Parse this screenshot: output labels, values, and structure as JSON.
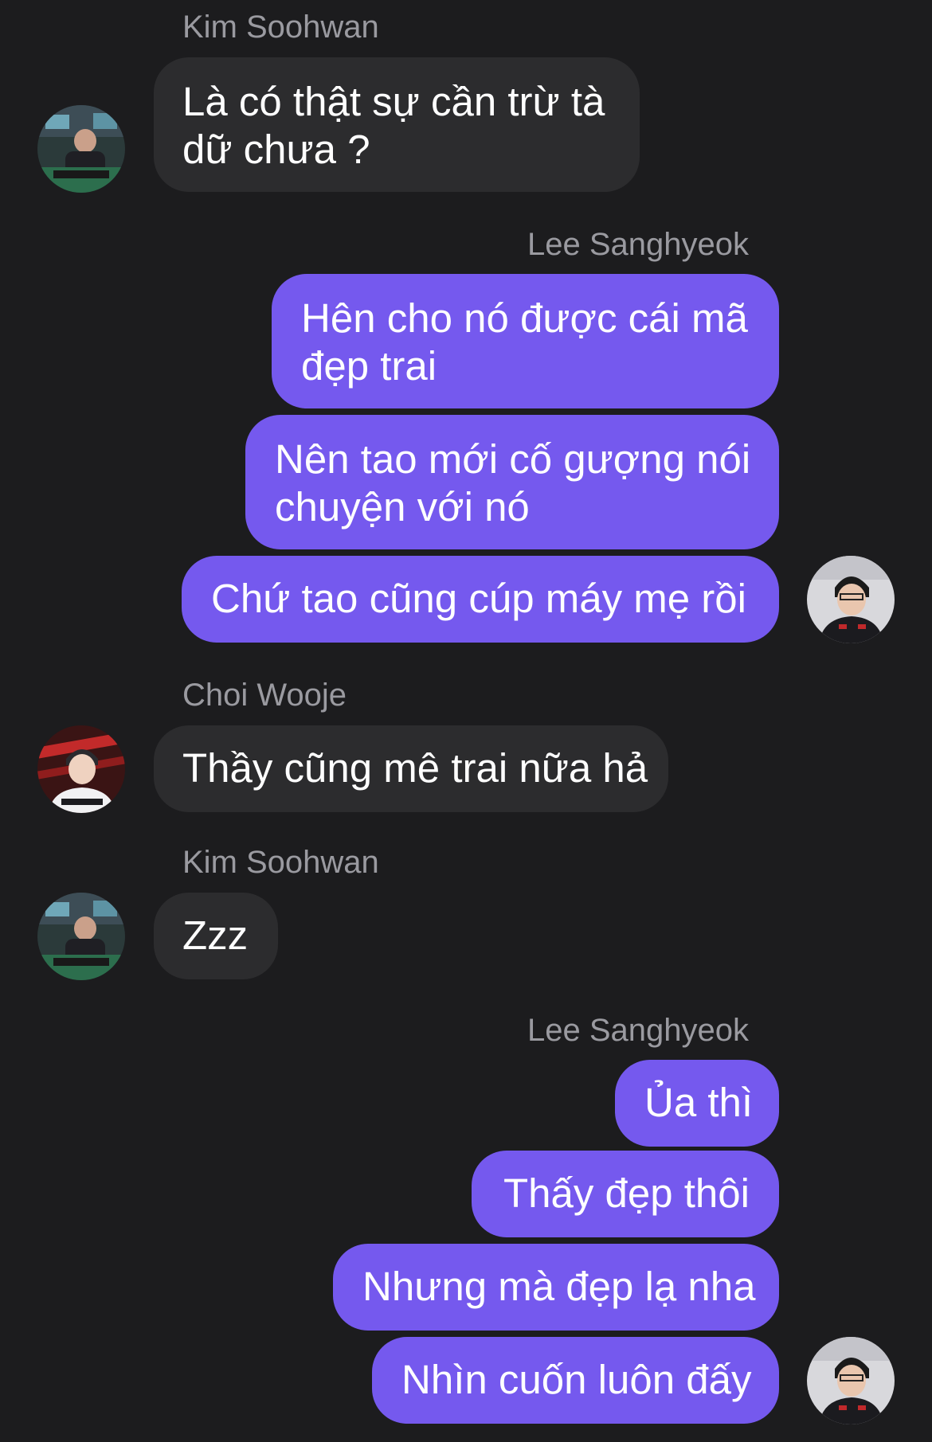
{
  "messages": {
    "m1": {
      "sender": "Kim Soohwan",
      "lines": [
        "Là có thật sự cần trừ tà",
        "dữ chưa ?"
      ]
    },
    "m2": {
      "sender": "Lee Sanghyeok",
      "lines": [
        "Hên cho nó được cái mã",
        "đẹp trai"
      ]
    },
    "m3": {
      "lines": [
        "Nên tao mới cố gượng nói",
        "chuyện với nó"
      ]
    },
    "m4": {
      "lines": [
        "Chứ tao cũng cúp máy mẹ rồi"
      ]
    },
    "m5": {
      "sender": "Choi Wooje",
      "lines": [
        "Thầy cũng mê trai nữa hả"
      ]
    },
    "m6": {
      "sender": "Kim Soohwan",
      "lines": [
        "Zzz"
      ]
    },
    "m7": {
      "sender": "Lee Sanghyeok",
      "lines": [
        "Ủa thì"
      ]
    },
    "m8": {
      "lines": [
        "Thấy đẹp thôi"
      ]
    },
    "m9": {
      "lines": [
        "Nhưng mà đẹp lạ nha"
      ]
    },
    "m10": {
      "lines": [
        "Nhìn cuốn luôn đấy"
      ]
    }
  },
  "colors": {
    "background": "#1c1c1e",
    "incoming_bubble": "#2c2c2e",
    "outgoing_bubble": "#7559ee",
    "sender_name": "#9a9aa0",
    "text": "#ffffff"
  },
  "icons": {
    "avatar_kim_soohwan": "avatar-photo",
    "avatar_lee_sanghyeok": "avatar-photo",
    "avatar_choi_wooje": "avatar-photo"
  }
}
